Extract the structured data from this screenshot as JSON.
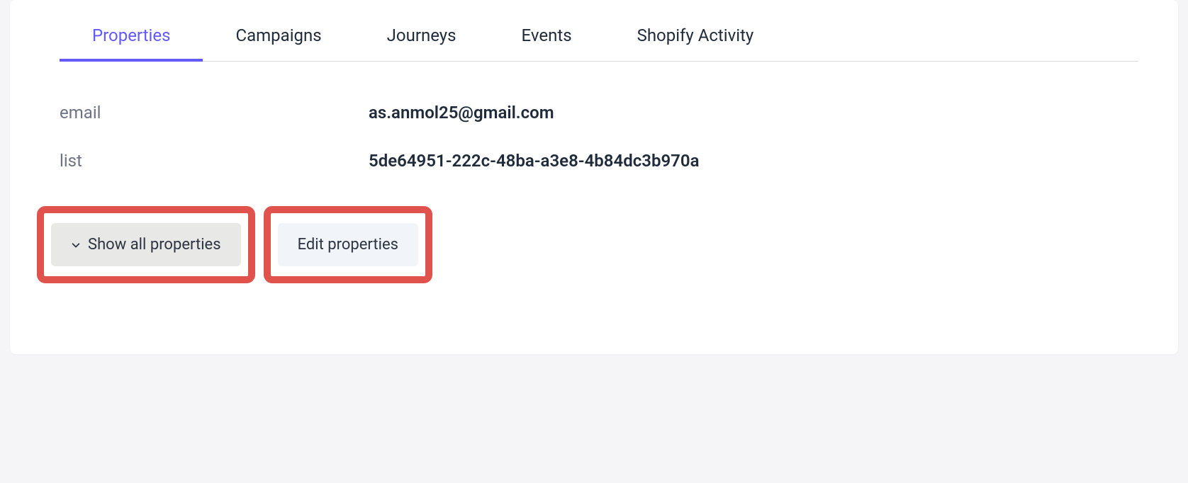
{
  "tabs": [
    {
      "label": "Properties",
      "active": true
    },
    {
      "label": "Campaigns",
      "active": false
    },
    {
      "label": "Journeys",
      "active": false
    },
    {
      "label": "Events",
      "active": false
    },
    {
      "label": "Shopify Activity",
      "active": false
    }
  ],
  "properties": [
    {
      "label": "email",
      "value": "as.anmol25@gmail.com"
    },
    {
      "label": "list",
      "value": "5de64951-222c-48ba-a3e8-4b84dc3b970a"
    }
  ],
  "actions": {
    "show_all_label": "Show all properties",
    "edit_label": "Edit properties"
  }
}
